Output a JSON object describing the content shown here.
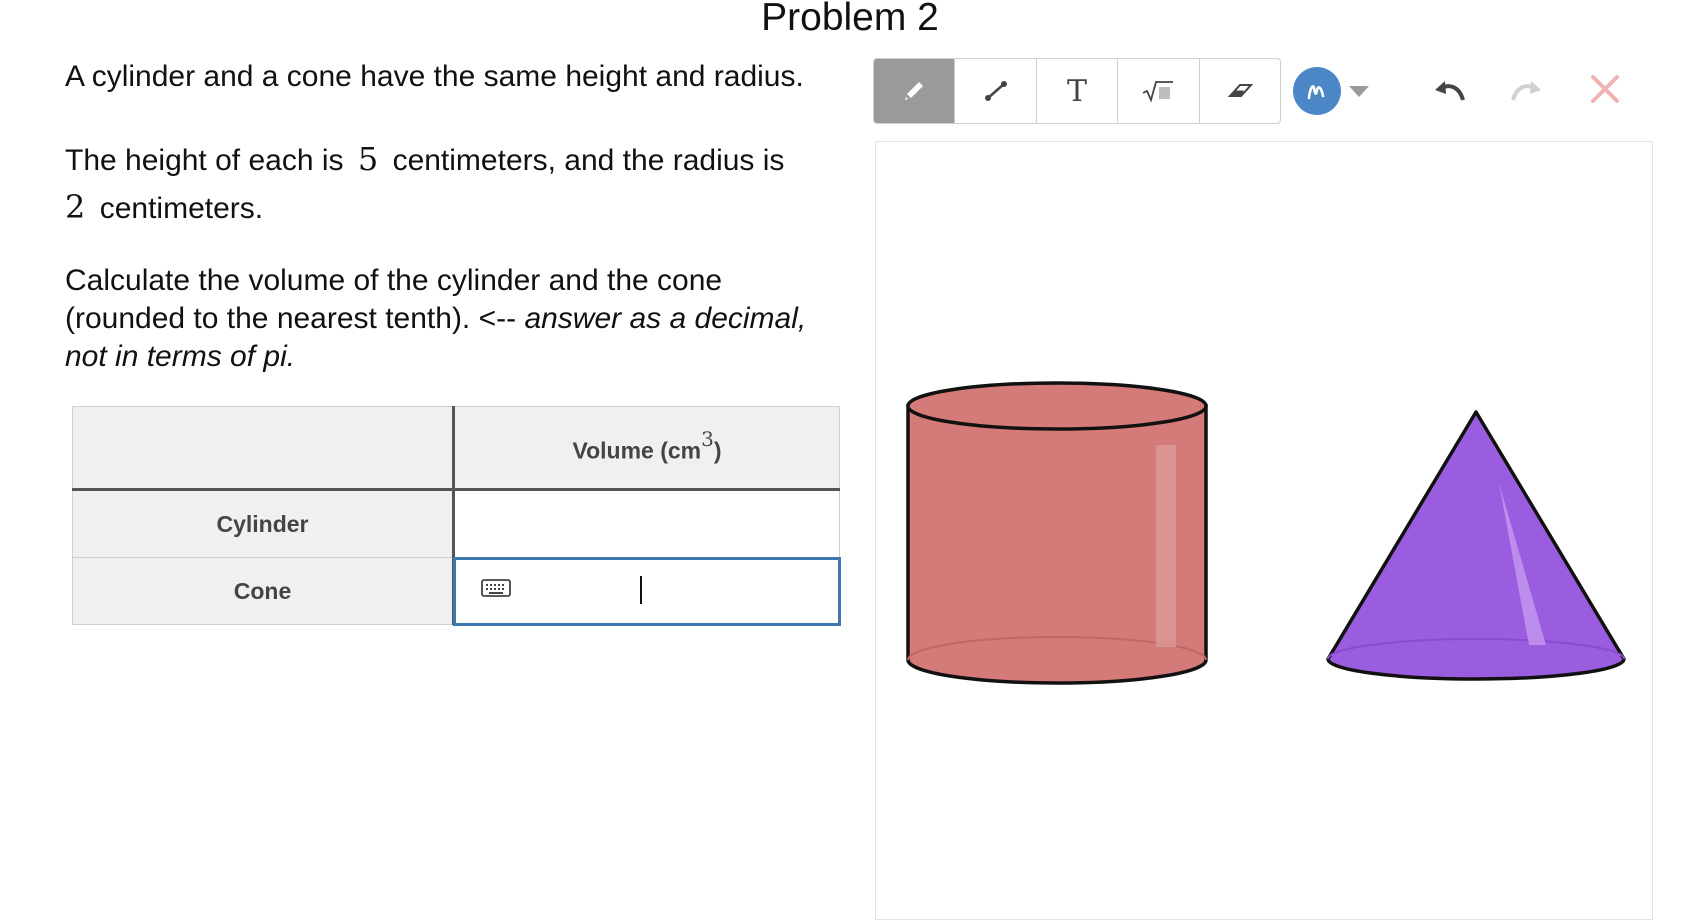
{
  "problem": {
    "title": "Problem 2",
    "line1": "A cylinder and a cone have the same height and radius.",
    "line2_a": "The height of each is",
    "height_value": "5",
    "line2_b": "centimeters, and the radius is",
    "radius_value": "2",
    "line2_c": "centimeters.",
    "line3_a": "Calculate the volume of the cylinder and the cone (rounded to the nearest tenth).  <-- ",
    "line3_b": "answer as a decimal, not in terms of pi."
  },
  "table": {
    "header_col": "Volume (cm",
    "header_exp": "3",
    "header_close": ")",
    "rows": [
      {
        "label": "Cylinder",
        "value": ""
      },
      {
        "label": "Cone",
        "value": ""
      }
    ]
  },
  "toolbar": {
    "tools": [
      "pencil-icon",
      "line-icon",
      "text-icon",
      "math-icon",
      "eraser-icon"
    ],
    "active_tool": "pencil-icon",
    "color": "#4b86c6",
    "undo_icon": "undo-icon",
    "redo_icon": "redo-icon",
    "close_icon": "close-icon",
    "text_tool_glyph": "T"
  },
  "colors": {
    "cylinder": "#d47a78",
    "cone": "#9b5de0",
    "input_focus": "#3d77b0",
    "close": "#f1b2b2"
  }
}
